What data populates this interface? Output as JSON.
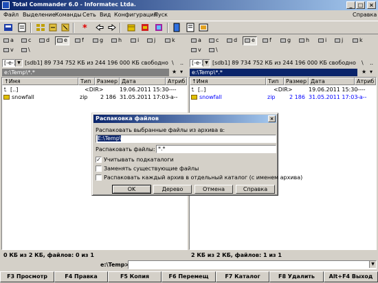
{
  "window": {
    "title": "Total Commander 6.0 - Informatec Ltda.",
    "help_menu": "Справка"
  },
  "menu": [
    "Файл",
    "Выделение",
    "Команды",
    "Сеть",
    "Вид",
    "Конфигурация",
    "Пуск"
  ],
  "drives_row1": [
    "a",
    "c",
    "d",
    "e",
    "f",
    "g",
    "h",
    "i",
    "j",
    "k"
  ],
  "drives_row2": [
    "v",
    "\\"
  ],
  "left": {
    "drive_combo": "[-e-]",
    "drive_info": "[sdb1]  89 734 752 КБ из 244 196 000 КБ свободно",
    "nav_back": "\\",
    "nav_up": "..",
    "path": "e:\\Temp\\*.*",
    "columns": [
      "↑Имя",
      "Тип",
      "Размер",
      "Дата",
      "Атриб"
    ],
    "rows": [
      {
        "name": "[..]",
        "type": "",
        "size": "<DIR>",
        "date": "19.06.2011 15:30",
        "attr": "----"
      },
      {
        "name": "snowfall",
        "type": "zip",
        "size": "2 186",
        "date": "31.05.2011 17:03",
        "attr": "-a--"
      }
    ],
    "status": "0 КБ из 2 КБ, файлов: 0 из 1"
  },
  "right": {
    "drive_combo": "[-e-]",
    "drive_info": "[sdb1]  89 734 752 КБ из 244 196 000 КБ свободно",
    "nav_back": "\\",
    "nav_up": "..",
    "path": "e:\\Temp\\*.*",
    "columns": [
      "↑Имя",
      "Тип",
      "Размер",
      "Дата",
      "Атриб"
    ],
    "rows": [
      {
        "name": "[..]",
        "type": "",
        "size": "<DIR>",
        "date": "19.06.2011 15:30",
        "attr": "----"
      },
      {
        "name": "snowfall",
        "type": "zip",
        "size": "2 186",
        "date": "31.05.2011 17:03",
        "attr": "-a--"
      }
    ],
    "status": "2 КБ из 2 КБ, файлов: 1 из 1"
  },
  "cmdline": {
    "label": "e:\\Temp>",
    "value": ""
  },
  "fkeys": [
    "F3 Просмотр",
    "F4 Правка",
    "F5 Копия",
    "F6 Перемещ",
    "F7 Каталог",
    "F8 Удалить",
    "Alt+F4 Выход"
  ],
  "dialog": {
    "title": "Распаковка файлов",
    "close_glyph": "×",
    "dest_label": "Распаковать выбранные файлы из архива в:",
    "dest_value": "E:\\Temp\\",
    "mask_label": "Распаковать файлы:",
    "mask_value": "*.*",
    "check1": "Учитывать подкаталоги",
    "check1_checked": true,
    "check2": "Заменять существующие файлы",
    "check2_checked": false,
    "check3": "Распаковать каждый архив в отдельный каталог (с именем архива)",
    "check3_checked": false,
    "buttons": {
      "ok": "OK",
      "tree": "Дерево",
      "cancel": "Отмена",
      "help": "Справка"
    }
  },
  "colors": {
    "title_active": "#0a246a",
    "panel_active_path": "#0a246a",
    "panel_inactive_path": "#808080",
    "selected_file": "#0000ff"
  }
}
